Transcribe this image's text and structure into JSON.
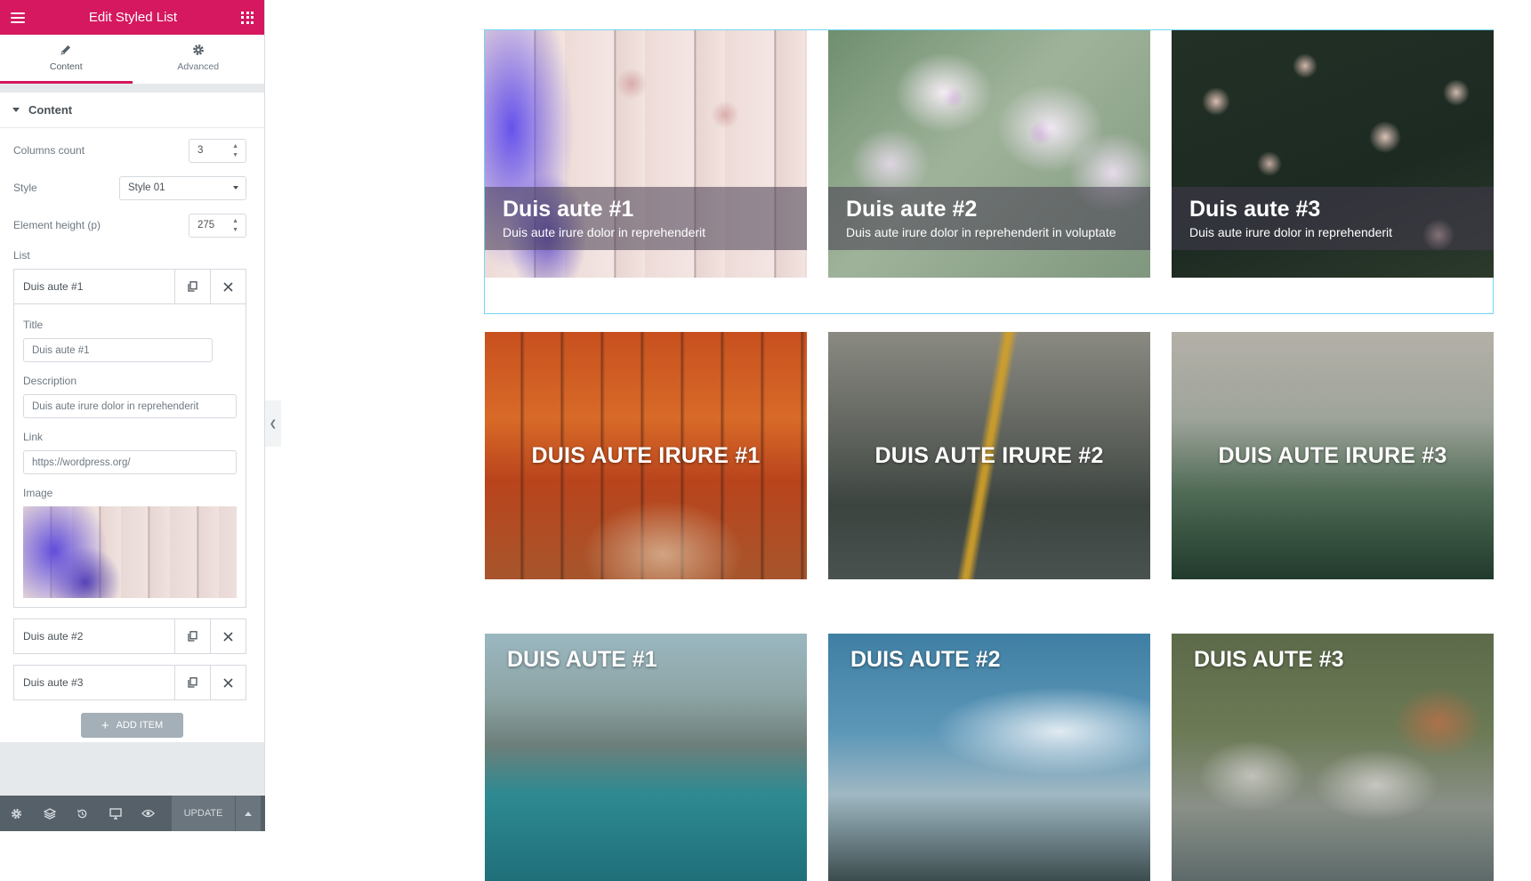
{
  "header": {
    "title": "Edit Styled List"
  },
  "tabs": [
    {
      "label": "Content"
    },
    {
      "label": "Advanced"
    }
  ],
  "section": {
    "title": "Content"
  },
  "controls": {
    "columns_label": "Columns count",
    "columns_value": "3",
    "style_label": "Style",
    "style_value": "Style 01",
    "height_label": "Element height (p)",
    "height_value": "275",
    "list_label": "List"
  },
  "repeater": {
    "items": [
      {
        "title": "Duis aute #1"
      },
      {
        "title": "Duis aute #2"
      },
      {
        "title": "Duis aute #3"
      }
    ],
    "expanded": {
      "title_label": "Title",
      "title_value": "Duis aute #1",
      "desc_label": "Description",
      "desc_value": "Duis aute irure dolor in reprehenderit",
      "link_label": "Link",
      "link_value": "https://wordpress.org/",
      "image_label": "Image"
    },
    "add_label": "ADD ITEM"
  },
  "footer": {
    "update_label": "UPDATE"
  },
  "preview": {
    "row1": [
      {
        "title": "Duis aute #1",
        "desc": "Duis aute irure dolor in reprehenderit"
      },
      {
        "title": "Duis aute #2",
        "desc": "Duis aute irure dolor in reprehenderit in voluptate"
      },
      {
        "title": "Duis aute #3",
        "desc": "Duis aute irure dolor in reprehenderit"
      }
    ],
    "row2": [
      {
        "title": "DUIS AUTE IRURE #1"
      },
      {
        "title": "DUIS AUTE IRURE #2"
      },
      {
        "title": "DUIS AUTE IRURE #3"
      }
    ],
    "row3": [
      {
        "title": "DUIS AUTE #1"
      },
      {
        "title": "DUIS AUTE #2"
      },
      {
        "title": "DUIS AUTE #3"
      }
    ]
  },
  "colors": {
    "accent": "#d5185f",
    "outline": "#71d7f7",
    "footer": "#556068"
  },
  "icons": [
    "hamburger-icon",
    "apps-grid-icon",
    "pencil-icon",
    "gear-icon",
    "duplicate-icon",
    "close-icon",
    "plus-icon",
    "settings-icon",
    "layers-icon",
    "history-icon",
    "responsive-icon",
    "eye-icon",
    "chevron-up-icon",
    "chevron-left-icon"
  ]
}
